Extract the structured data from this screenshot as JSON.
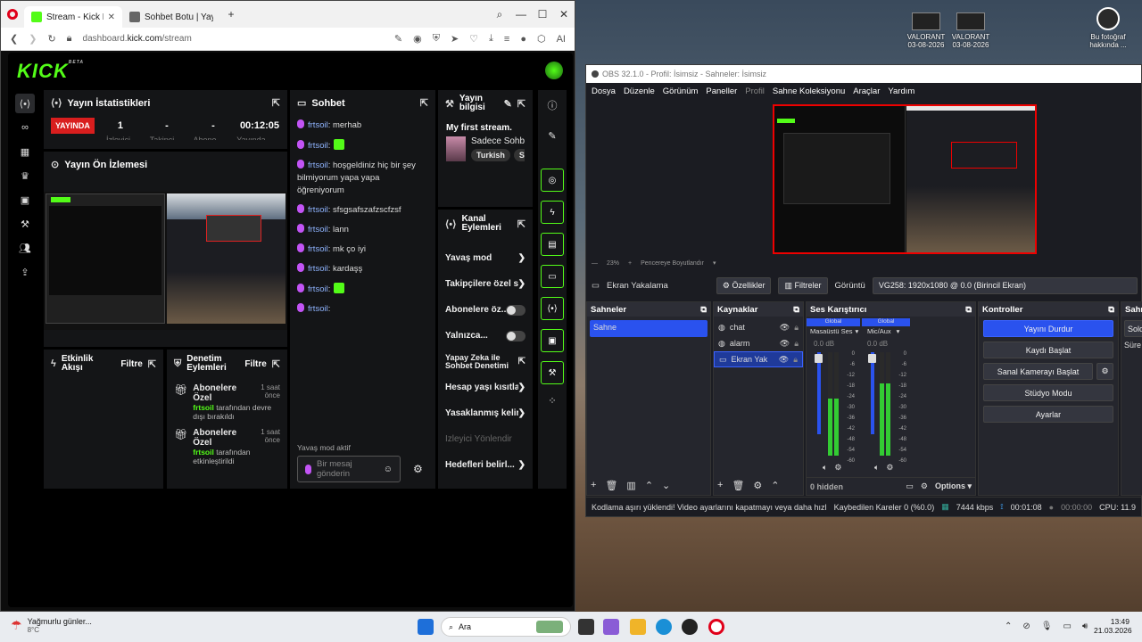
{
  "desktop": {
    "icons": [
      {
        "label": "VALORANT",
        "sub": "03-08-2026"
      },
      {
        "label": "VALORANT",
        "sub": "03-08-2026"
      },
      {
        "label": "Bu fotoğraf",
        "sub": "hakkında ..."
      }
    ]
  },
  "browser": {
    "tabs": [
      {
        "title": "Stream - Kick Dashboard",
        "active": true
      },
      {
        "title": "Sohbet Botu | Yayınını gü",
        "active": false
      }
    ],
    "url_prefix": "dashboard.",
    "url_domain": "kick.com",
    "url_path": "/stream",
    "ai_label": "AI"
  },
  "kick": {
    "logo": "KICK",
    "beta": "BETA",
    "stats": {
      "title": "Yayın İstatistikleri",
      "live_badge": "YAYINDA",
      "viewers": "1",
      "followers": "-",
      "subs": "-",
      "duration": "00:12:05",
      "sub_labels": [
        "İzleyici",
        "Takipçi",
        "Abone",
        "Yayında"
      ]
    },
    "preview_title": "Yayın Ön İzlemesi",
    "chat": {
      "title": "Sohbet",
      "messages": [
        {
          "user": "frtsoil",
          "text": ": merhab"
        },
        {
          "user": "frtsoil",
          "text": ":",
          "emote": true
        },
        {
          "user": "frtsoil",
          "text": ": hoşgeldiniz hiç bir şey bilmiyorum yapa yapa öğreniyorum"
        },
        {
          "user": "frtsoil",
          "text": ": sfsgsafszafzscfzsf"
        },
        {
          "user": "frtsoil",
          "text": ": lann"
        },
        {
          "user": "frtsoil",
          "text": ": mk ço iyi"
        },
        {
          "user": "frtsoil",
          "text": ": kardaşş"
        },
        {
          "user": "frtsoil",
          "text": ":",
          "emote": true
        },
        {
          "user": "frtsoil",
          "text": ":"
        }
      ],
      "slow_mode": "Yavaş mod aktif",
      "input_placeholder": "Bir mesaj gönderin"
    },
    "stream_info": {
      "title": "Yayın bilgisi",
      "stream_name": "My first stream.",
      "category": "Sadece Sohb",
      "tags": [
        "Turkish",
        "S"
      ]
    },
    "channel_actions": {
      "title": "Kanal Eylemleri",
      "items": [
        {
          "label": "Yavaş mod",
          "kind": "chevron"
        },
        {
          "label": "Takipçilere özel s",
          "kind": "chevron"
        },
        {
          "label": "Abonelere öz...",
          "kind": "toggle"
        },
        {
          "label": "Yalnızca...",
          "kind": "toggle"
        },
        {
          "label": "Yapay Zeka ile Sohbet Denetimi",
          "kind": "external"
        },
        {
          "label": "Hesap yaşı kısıtla",
          "kind": "chevron"
        },
        {
          "label": "Yasaklanmış kelir",
          "kind": "chevron"
        },
        {
          "label": "İzleyici Yönlendir",
          "kind": "disabled"
        },
        {
          "label": "Hedefleri belirl...",
          "kind": "chevron"
        }
      ]
    },
    "activity": {
      "title": "Etkinlik Akışı",
      "filter": "Filtre"
    },
    "moderation": {
      "title": "Denetim Eylemleri",
      "filter": "Filtre",
      "items": [
        {
          "title": "Abonelere Özel",
          "time": "1 saat önce",
          "user": "frtsoil",
          "desc": " tarafından devre dışı bırakıldı"
        },
        {
          "title": "Abonelere Özel",
          "time": "1 saat önce",
          "user": "frtsoil",
          "desc": " tarafından etkinleştirildi"
        }
      ]
    }
  },
  "obs": {
    "title": "OBS 32.1.0 - Profil: İsimsiz - Sahneler: İsimsiz",
    "menu": [
      "Dosya",
      "Düzenle",
      "Görünüm",
      "Paneller",
      "Profil",
      "Sahne Koleksiyonu",
      "Araçlar",
      "Yardım"
    ],
    "zoom": "23%",
    "fit_label": "Pencereye Boyutlandır",
    "source_bar": {
      "source": "Ekran Yakalama",
      "props": "Özellikler",
      "filters": "Filtreler",
      "display_label": "Görüntü",
      "display_value": "VG258: 1920x1080 @ 0.0 (Birincil Ekran)"
    },
    "scenes": {
      "title": "Sahneler",
      "items": [
        "Sahne"
      ]
    },
    "sources": {
      "title": "Kaynaklar",
      "items": [
        "chat",
        "alarm",
        "Ekran Yak"
      ]
    },
    "mixer": {
      "title": "Ses Karıştırıcı",
      "channels": [
        {
          "global": "Global",
          "name": "Masaüstü Ses",
          "db": "0.0 dB",
          "level": 0.55
        },
        {
          "global": "Global",
          "name": "Mic/Aux",
          "db": "0.0 dB",
          "level": 0.7
        }
      ],
      "scale": [
        "0",
        "-6",
        "-12",
        "-18",
        "-24",
        "-30",
        "-36",
        "-42",
        "-48",
        "-54",
        "-60"
      ],
      "hidden": "0 hidden",
      "options": "Options"
    },
    "controls": {
      "title": "Kontroller",
      "buttons": [
        "Yayını Durdur",
        "Kaydı Başlat",
        "Sanal Kamerayı Başlat",
        "Stüdyo Modu",
        "Ayarlar"
      ]
    },
    "right_dock": {
      "title": "Sahr",
      "items": [
        "Solo",
        "Süre"
      ]
    },
    "status": {
      "warning": "Kodlama aşırı yüklendi! Video ayarlarını kapatmayı veya daha hızlı bir",
      "dropped": "Kaybedilen Kareler 0 (%0.0)",
      "bitrate": "7444 kbps",
      "live_time": "00:01:08",
      "rec_time": "00:00:00",
      "cpu": "CPU: 11.9"
    }
  },
  "taskbar": {
    "weather_title": "Yağmurlu günler...",
    "weather_temp": "8°C",
    "search": "Ara",
    "time": "13:49",
    "date": "21.03.2026"
  }
}
